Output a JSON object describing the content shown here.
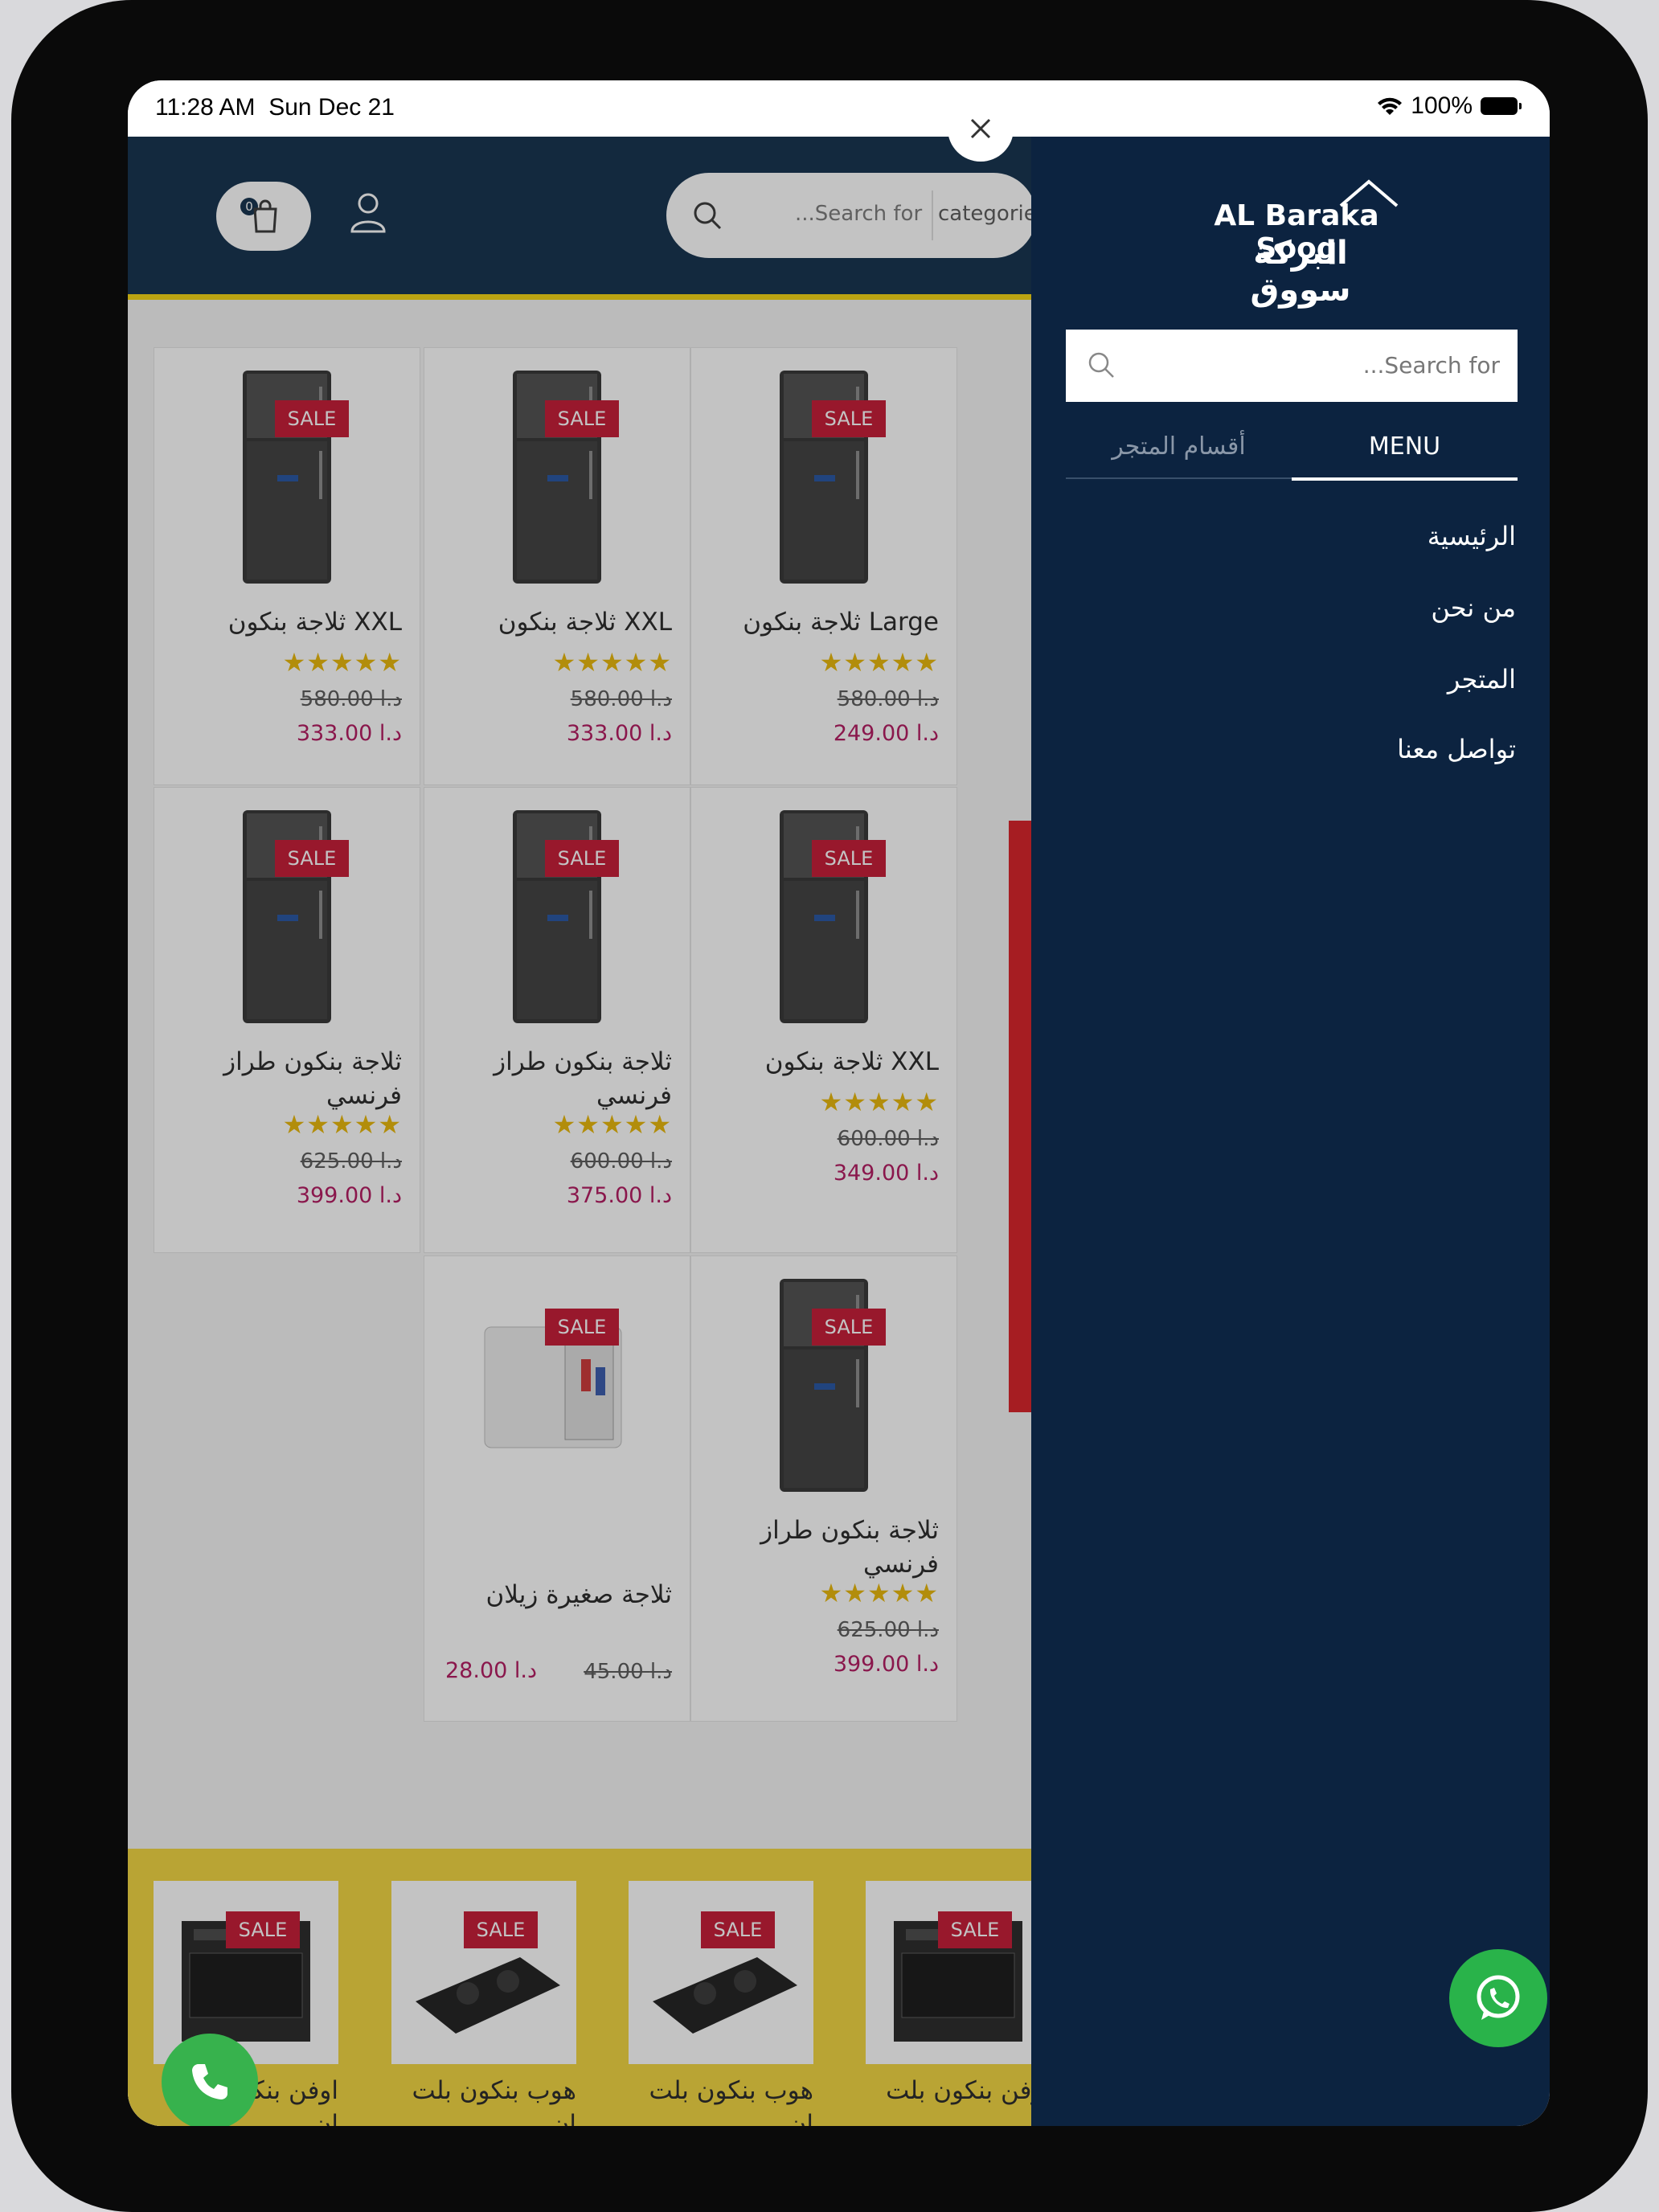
{
  "status_bar": {
    "time": "11:28 AM  Sun Dec 21",
    "battery": "100%"
  },
  "header": {
    "cart_count": "0",
    "search_placeholder": "...Search for",
    "categories_label": "categories"
  },
  "products": [
    {
      "name": "ثلاجة بنكون Large",
      "old_price": "580.00 د.ا",
      "new_price": "249.00 د.ا",
      "badge": "SALE",
      "rating": 5
    },
    {
      "name": "ثلاجة بنكون XXL",
      "old_price": "580.00 د.ا",
      "new_price": "333.00 د.ا",
      "badge": "SALE",
      "rating": 5
    },
    {
      "name": "ثلاجة بنكون XXL",
      "old_price": "580.00 د.ا",
      "new_price": "333.00 د.ا",
      "badge": "SALE",
      "rating": 5
    },
    {
      "name": "ثلاجة بنكون XXL",
      "old_price": "600.00 د.ا",
      "new_price": "349.00 د.ا",
      "badge": "SALE",
      "rating": 5
    },
    {
      "name": "ثلاجة بنكون طراز فرنسي",
      "old_price": "600.00 د.ا",
      "new_price": "375.00 د.ا",
      "badge": "SALE",
      "rating": 5
    },
    {
      "name": "ثلاجة بنكون طراز فرنسي",
      "old_price": "625.00 د.ا",
      "new_price": "399.00 د.ا",
      "badge": "SALE",
      "rating": 5
    },
    {
      "name": "ثلاجة بنكون طراز فرنسي",
      "old_price": "625.00 د.ا",
      "new_price": "399.00 د.ا",
      "badge": "SALE",
      "rating": 5
    },
    {
      "name": "ثلاجة صغيرة زيلان",
      "old_price": "45.00 د.ا",
      "new_price": "28.00 د.ا",
      "badge": "SALE",
      "rating": 0
    }
  ],
  "mini_products": [
    {
      "name": "اوفن بنكون بلت ان",
      "badge": "SALE"
    },
    {
      "name": "هوب بنكون بلت ان",
      "badge": "SALE"
    },
    {
      "name": "هوب بنكون بلت ان",
      "badge": "SALE"
    },
    {
      "name": "اوفن بنكون بلت ان",
      "badge": "SALE"
    }
  ],
  "sidebar": {
    "logo_en": "AL Baraka Sooq",
    "logo_ar": "البركة سووق",
    "search_placeholder": "...Search for",
    "tabs": [
      {
        "label": "MENU"
      },
      {
        "label": "أقسام المتجر"
      }
    ],
    "menu": [
      {
        "label": "الرئيسية"
      },
      {
        "label": "من نحن"
      },
      {
        "label": "المتجر"
      },
      {
        "label": "تواصل معنا"
      }
    ]
  },
  "colors": {
    "navy": "#0c2340",
    "accent_yellow": "#f6d40b",
    "sale_red": "#c4122f",
    "price": "#b0115a",
    "whatsapp": "#29b34a"
  }
}
